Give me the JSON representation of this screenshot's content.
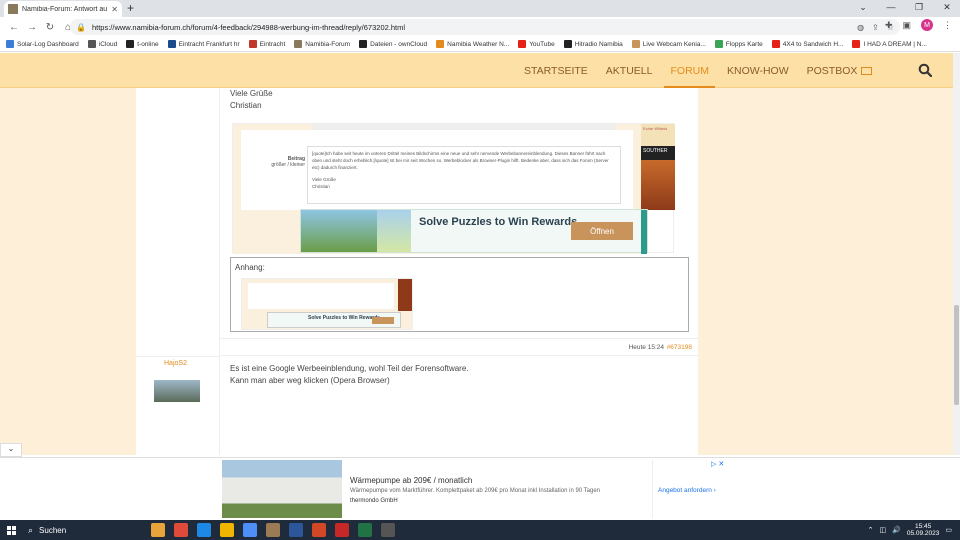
{
  "browser": {
    "tab_title": "Namibia-Forum: Antwort auf Th",
    "new_tab": "+",
    "url": "https://www.namibia-forum.ch/forum/4-feedback/294988-werbung-im-thread/reply/673202.html",
    "avatar_letter": "M"
  },
  "bookmarks": [
    {
      "label": "Solar-Log Dashboard",
      "color": "#3b7dd8"
    },
    {
      "label": "iCloud",
      "color": "#555555"
    },
    {
      "label": "t-online",
      "color": "#222222"
    },
    {
      "label": "Eintracht Frankfurt hr",
      "color": "#1a4c8c"
    },
    {
      "label": "Eintracht",
      "color": "#c0392b"
    },
    {
      "label": "Namibia-Forum",
      "color": "#8a7a5c"
    },
    {
      "label": "Dateien - ownCloud",
      "color": "#222222"
    },
    {
      "label": "Namibia Weather N...",
      "color": "#e38c1d"
    },
    {
      "label": "YouTube",
      "color": "#e62117"
    },
    {
      "label": "Hitradio Namibia",
      "color": "#222222"
    },
    {
      "label": "Live Webcam Kenia...",
      "color": "#c9935c"
    },
    {
      "label": "Flopps Karte",
      "color": "#3aa655"
    },
    {
      "label": "4X4 to Sandwich H...",
      "color": "#e62117"
    },
    {
      "label": "I HAD A DREAM | N...",
      "color": "#e62117"
    }
  ],
  "site_nav": {
    "items": [
      "STARTSEITE",
      "AKTUELL",
      "FORUM",
      "KNOW-HOW",
      "POSTBOX"
    ],
    "active": "FORUM"
  },
  "post1": {
    "greeting": "Viele Grüße",
    "signature": "Christian",
    "quote": {
      "label_title": "Beitrag",
      "label_sub": "größer / kleiner",
      "text": "[quote]Ich habe seit heute im unteren Drittel meines Bildschirms eine neue und sehr nervende Werbebannereinblendung. Dieses Banner führt nach oben und steht doch erheblich.[/quote] Ist bei mir seit Wochen so. Werbeblocker als Browser-Plugin hilft. Bedenke aber, dass sich das Forum (Server etc) dadurch finanziert.",
      "greeting": "Viele Grüße",
      "signature": "Christian",
      "side_ad_top": "Echte Wildnis",
      "side_ad_mid": "SOUTHER"
    },
    "ad": {
      "headline": "Solve Puzzles to Win Rewards",
      "button": "Öffnen"
    },
    "attachment_label": "Anhang:",
    "thumb_ad": "Solve Puzzles to Win Rewards",
    "time": "Heute 15:24",
    "post_number": "#673198"
  },
  "post2": {
    "user": "HajoS2",
    "line1": "Es ist eine Google Werbeeinblendung, wohl Teil der Forensoftware.",
    "line2": "Kann man aber weg klicken (Opera Browser)"
  },
  "bottom_ad": {
    "title": "Wärmepumpe ab 209€ / monatlich",
    "subtitle": "Wärmepumpe vom Marktführer. Komplettpaket ab 209€ pro Monat inkl Installation in 90 Tagen",
    "brand": "thermondo GmbH",
    "cta": "Angebot anfordern"
  },
  "taskbar": {
    "search_label": "Suchen",
    "time": "15:45",
    "date": "05.09.2023",
    "apps": [
      "#e8a33b",
      "#e04a3a",
      "#1e88e5",
      "#f2b600",
      "#4e8ef7",
      "#9c7b54",
      "#2b579a",
      "#d24726",
      "#c62828",
      "#217346",
      "#555555"
    ]
  }
}
